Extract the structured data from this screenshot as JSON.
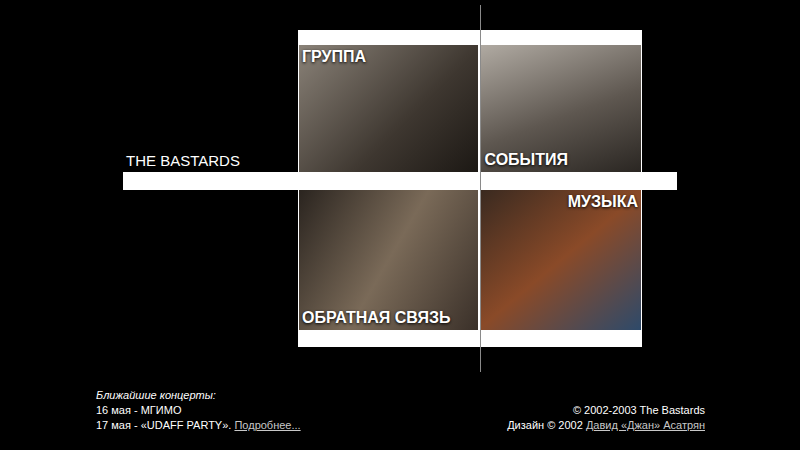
{
  "site": {
    "title": "THE BASTARDS"
  },
  "menu": [
    {
      "label": "ГРУППА"
    },
    {
      "label": "СОБЫТИЯ"
    },
    {
      "label": "ОБРАТНАЯ СВЯЗЬ"
    },
    {
      "label": "МУЗЫКА"
    }
  ],
  "concerts": {
    "heading": "Ближайшие концерты:",
    "items": [
      {
        "text": "16 мая - МГИМО",
        "link": ""
      },
      {
        "text": "17 мая - «UDAFF PARTY».",
        "link": "Подробнее..."
      }
    ]
  },
  "footer": {
    "copyright": "© 2002-2003 The Bastards",
    "design": "Дизайн © 2002",
    "designer": "Давид «Джан» Асатрян"
  }
}
